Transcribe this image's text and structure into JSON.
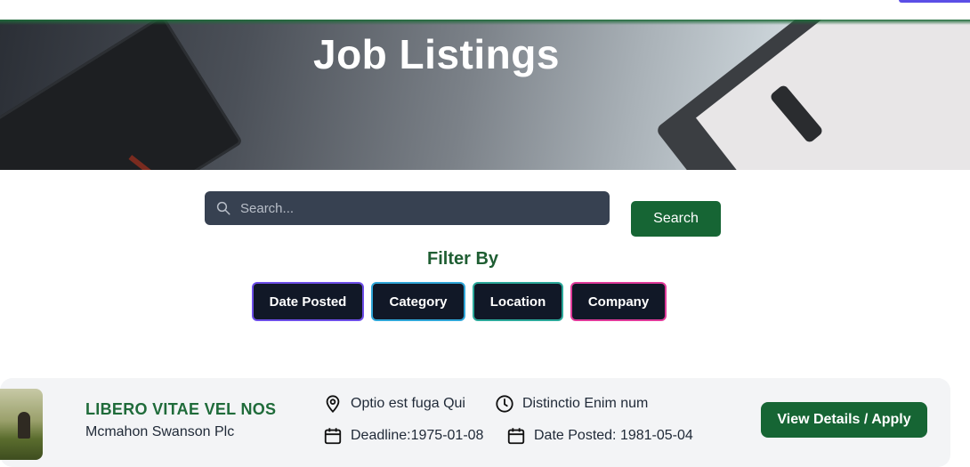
{
  "hero": {
    "title": "Job Listings"
  },
  "search": {
    "placeholder": "Search...",
    "button_label": "Search"
  },
  "filter": {
    "title": "Filter By",
    "chips": [
      {
        "label": "Date Posted",
        "border_color": "#6d4ee8"
      },
      {
        "label": "Category",
        "border_color": "#2fa6d8"
      },
      {
        "label": "Location",
        "border_color": "#2ba89a"
      },
      {
        "label": "Company",
        "border_color": "#e03a9a"
      }
    ]
  },
  "job": {
    "title": "LIBERO VITAE VEL NOS",
    "company": "Mcmahon Swanson Plc",
    "location": "Optio est fuga Qui",
    "job_type": "Distinctio Enim num",
    "deadline": "Deadline:1975-01-08",
    "date_posted": "Date Posted: 1981-05-04",
    "apply_label": "View Details / Apply"
  },
  "icons": {
    "search": "search-icon",
    "location": "map-pin-icon",
    "clock": "clock-icon",
    "calendar": "calendar-icon"
  },
  "colors": {
    "brand_green": "#166534",
    "heading_green": "#1f6b3a",
    "search_bg": "#374151",
    "chip_bg": "#111827"
  }
}
